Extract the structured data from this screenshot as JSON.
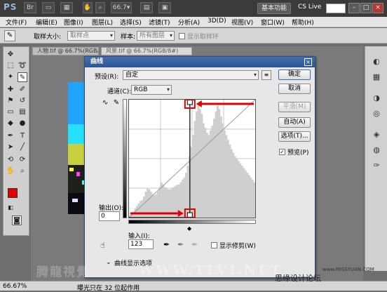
{
  "appbar": {
    "logo": "PS",
    "basic_workspace": "基本功能",
    "cslive": "CS Live",
    "window_controls": [
      "–",
      "□",
      "×"
    ]
  },
  "menu": [
    "文件(F)",
    "编辑(E)",
    "图像(I)",
    "图层(L)",
    "选择(S)",
    "滤镜(T)",
    "分析(A)",
    "3D(D)",
    "视图(V)",
    "窗口(W)",
    "帮助(H)"
  ],
  "options": {
    "sample_size_label": "取样大小:",
    "sample_size_value": "取样点",
    "sample_label": "样本:",
    "sample_value": "所有图层",
    "show_ring_label": "显示取样环"
  },
  "documents": {
    "tab1": "人物.tif @ 66.7%(RGB/8#)",
    "tab2": "风景.tif @ 66.7%(RGB/8#)"
  },
  "status": {
    "zoom": "66.67%",
    "message": "曝光只在 32 位起作用"
  },
  "dialog": {
    "title": "曲线",
    "preset_label": "预设(R):",
    "preset_value": "自定",
    "channel_label": "通道(C):",
    "channel_value": "RGB",
    "output_label": "输出(O):",
    "output_value": "0",
    "input_label": "输入(I):",
    "input_value": "123",
    "show_clipping_label": "显示修剪(W)",
    "display_options_label": "曲线显示选项",
    "buttons": {
      "ok": "确定",
      "cancel": "取消",
      "smooth": "平滑(M)",
      "auto": "自动(A)",
      "options": "选项(T)..."
    },
    "preview_label": "预览(P)",
    "preview_checked": true
  },
  "watermark": {
    "left": "腾龍視覺",
    "www": "WWW.TLVI.NET",
    "right": "思缘设计论坛",
    "url": "www.MISSYUAN.COM"
  },
  "chart_data": {
    "type": "area",
    "title": "",
    "xlabel": "",
    "ylabel": "",
    "xlim": [
      0,
      255
    ],
    "ylim": [
      0,
      255
    ],
    "histogram": [
      2,
      3,
      5,
      8,
      10,
      12,
      14,
      15,
      18,
      22,
      25,
      24,
      22,
      20,
      19,
      20,
      22,
      26,
      30,
      28,
      26,
      25,
      24,
      24,
      25,
      26,
      27,
      28,
      28,
      30,
      32,
      34,
      38,
      44,
      52,
      60,
      70,
      82,
      90,
      96,
      92,
      88,
      80,
      76,
      72,
      70,
      74,
      78,
      84,
      90,
      95,
      92,
      86,
      80,
      74,
      70,
      66,
      62,
      58,
      55,
      52,
      50,
      48,
      46,
      44,
      42,
      40,
      38,
      36,
      34,
      32,
      30
    ],
    "curve_points": [
      [
        0,
        0
      ],
      [
        123,
        0
      ],
      [
        123,
        255
      ]
    ],
    "input_value": 123,
    "output_value": 0
  }
}
